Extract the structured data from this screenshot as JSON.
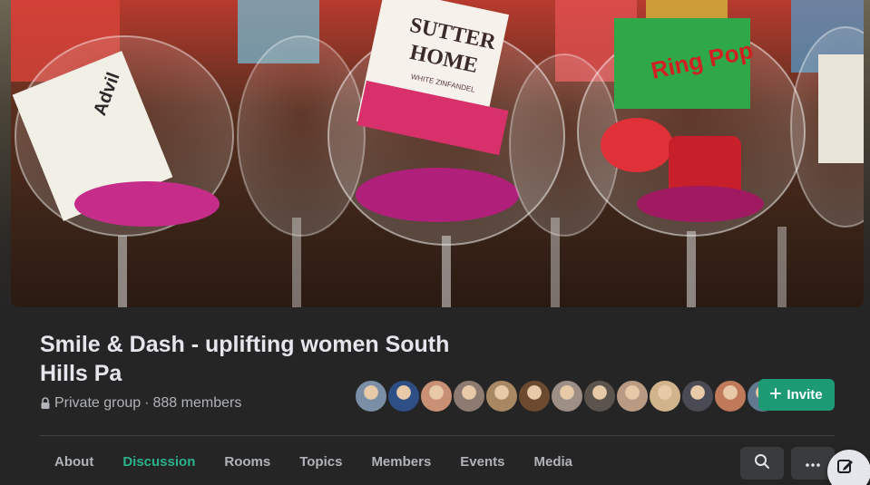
{
  "group": {
    "name": "Smile & Dash - uplifting women South Hills Pa",
    "privacy": "Private group",
    "separator": "·",
    "members": "888 members"
  },
  "cover": {
    "bottle_label_line1": "SUTTER",
    "bottle_label_line2": "HOME",
    "bottle_label_small": "WHITE ZINFANDEL",
    "snack_label": "Advil",
    "ring_pop_label": "Ring Pop"
  },
  "actions": {
    "invite_label": "Invite",
    "invite_icon": "plus-icon",
    "search_icon": "search-icon",
    "more_icon": "more-icon",
    "compose_icon": "compose-icon"
  },
  "tabs": [
    {
      "label": "About"
    },
    {
      "label": "Discussion"
    },
    {
      "label": "Rooms"
    },
    {
      "label": "Topics"
    },
    {
      "label": "Members"
    },
    {
      "label": "Events"
    },
    {
      "label": "Media"
    }
  ],
  "active_tab": "Discussion",
  "colors": {
    "accent": "#1b9a74",
    "active_tab": "#2ab38a",
    "background": "#252525"
  },
  "member_avatars": [
    "#7a8ea6",
    "#2e4f86",
    "#c99075",
    "#8d7b72",
    "#a88863",
    "#6b4a2f",
    "#9e8f86",
    "#5b534c",
    "#b99b84",
    "#d2b48c",
    "#4a4a55",
    "#c07a5a",
    "#62798f"
  ]
}
